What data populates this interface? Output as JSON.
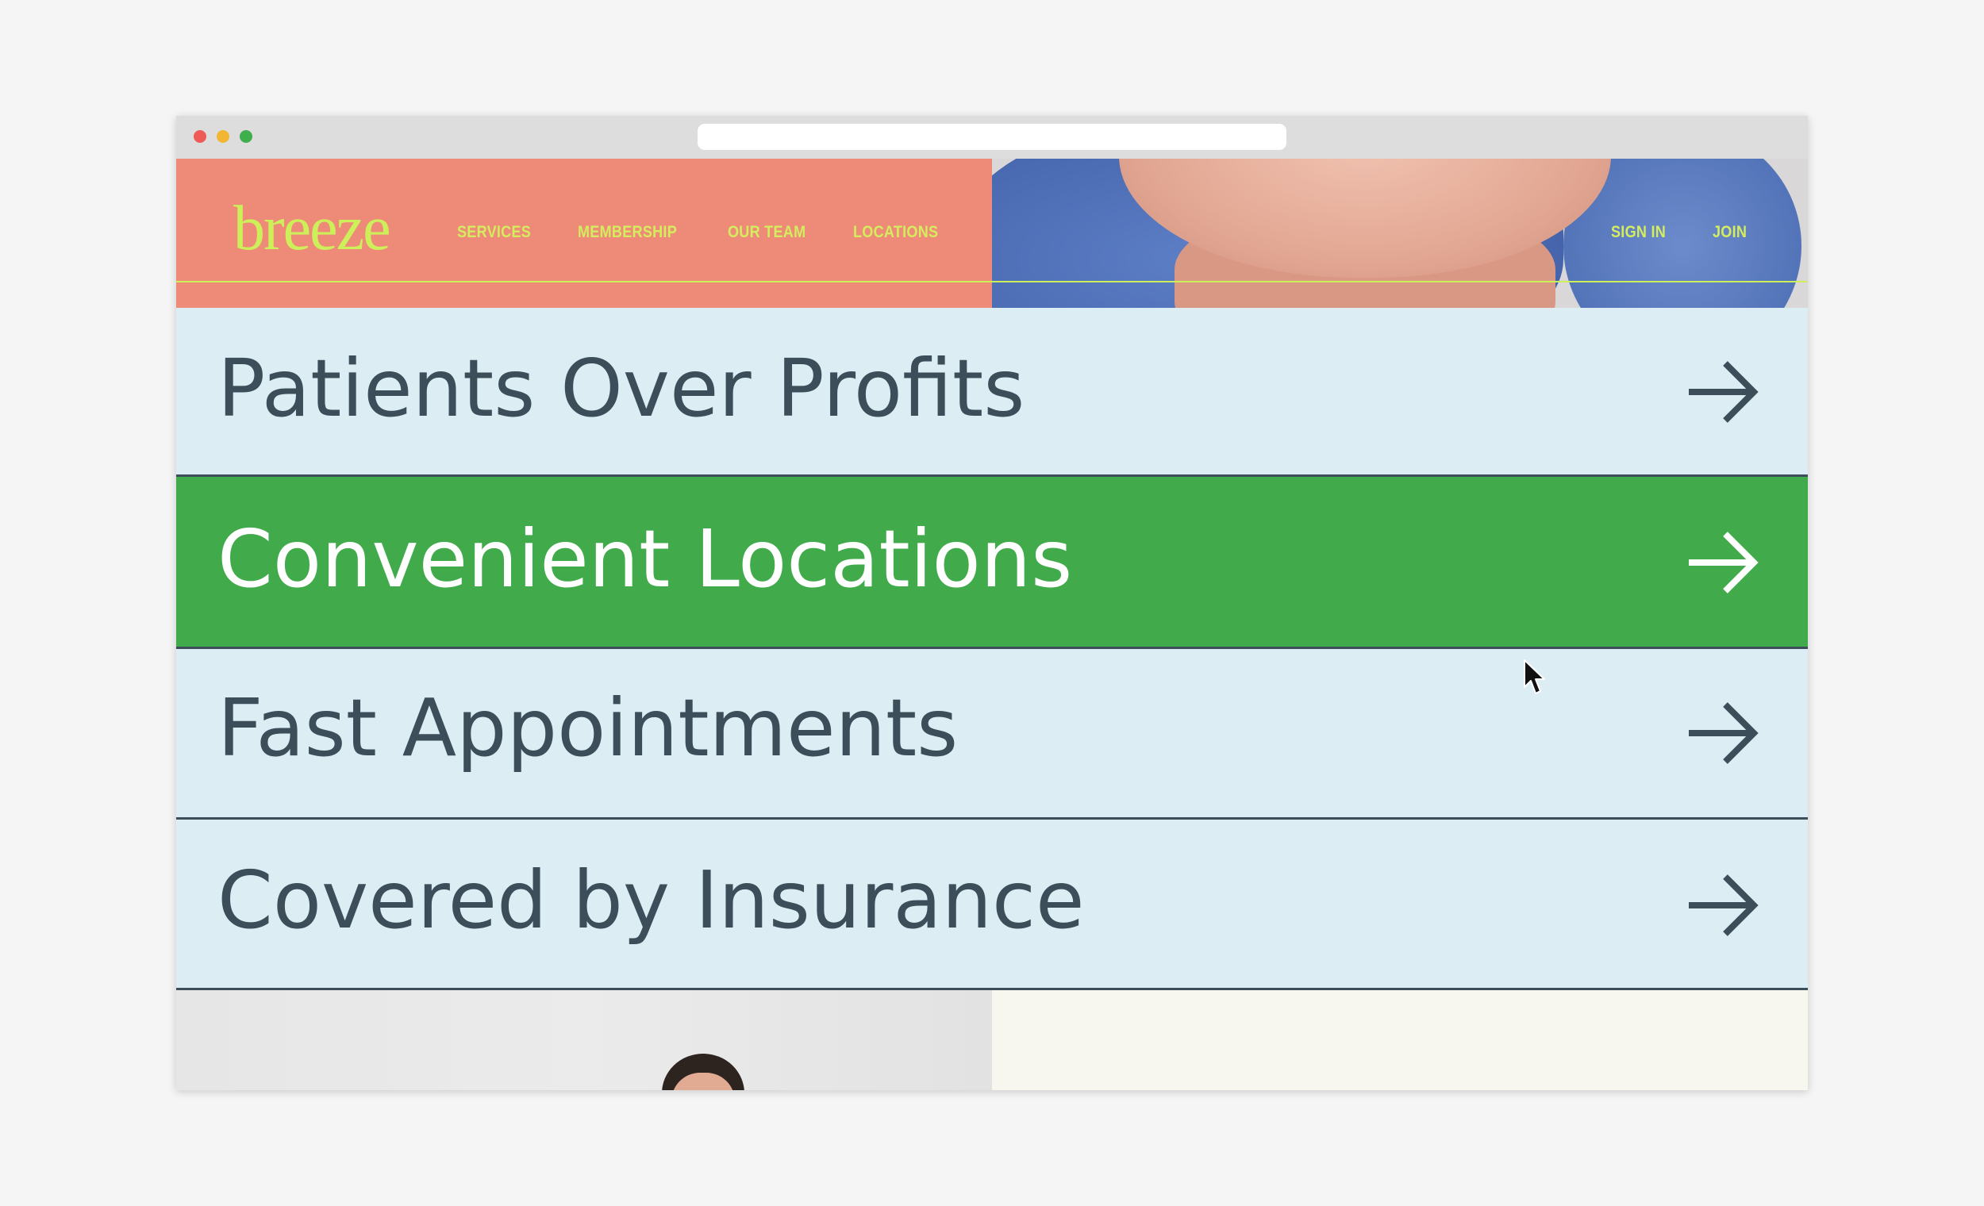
{
  "browser": {
    "traffic_lights": {
      "close": "#ee5a55",
      "minimize": "#f2b634",
      "maximize": "#3fae4d"
    },
    "url_bar_value": ""
  },
  "header": {
    "logo": "breeze",
    "nav": {
      "services": "SERVICES",
      "membership": "MEMBERSHIP",
      "our_team": "OUR TEAM",
      "locations": "LOCATIONS",
      "sign_in": "SIGN IN",
      "join": "JOIN"
    },
    "background_color": "#ee8b78",
    "accent_color": "#cdef5a"
  },
  "features": [
    {
      "label": "Patients Over Profits",
      "active": false,
      "icon": "arrow-right-icon"
    },
    {
      "label": "Convenient Locations",
      "active": true,
      "icon": "arrow-right-icon"
    },
    {
      "label": "Fast Appointments",
      "active": false,
      "icon": "arrow-right-icon"
    },
    {
      "label": "Covered by Insurance",
      "active": false,
      "icon": "arrow-right-icon"
    }
  ],
  "colors": {
    "row_background": "#ddedf4",
    "row_text": "#3b4e59",
    "active_background": "#41ab4b",
    "active_text": "#ffffff",
    "bottom_right_background": "#f7f6ef"
  }
}
